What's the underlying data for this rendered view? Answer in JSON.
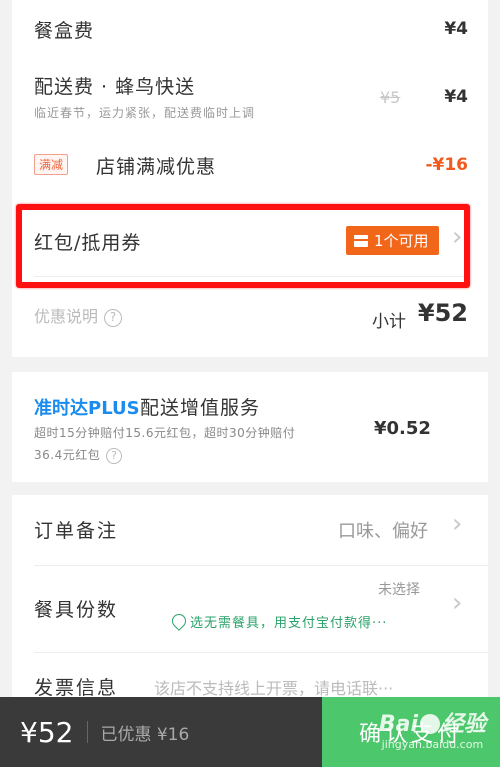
{
  "fees": {
    "box_fee_label": "餐盒费",
    "box_fee_value": "¥4",
    "delivery_label": "配送费 · 蜂鸟快送",
    "delivery_note": "临近春节，运力紧张，配送费临时上调",
    "delivery_original": "¥5",
    "delivery_value": "¥4",
    "discount_tag": "满减",
    "discount_label": "店铺满减优惠",
    "discount_value": "-¥16"
  },
  "coupon": {
    "label": "红包/抵用券",
    "badge": "1个可用"
  },
  "summary": {
    "discount_info": "优惠说明",
    "info_icon": "?",
    "subtotal_label": "小计",
    "subtotal_value": "¥52"
  },
  "plus": {
    "brand": "准时达PLUS",
    "title": "配送增值服务",
    "note_line1": "超时15分钟赔付15.6元红包，超时30分钟赔付",
    "note_line2": "36.4元红包",
    "info_icon": "?",
    "price": "¥0.52"
  },
  "order": {
    "remark_label": "订单备注",
    "remark_hint": "口味、偏好",
    "tableware_label": "餐具份数",
    "tableware_status": "未选择",
    "tableware_promo": "选无需餐具，用支付宝付款得···",
    "invoice_label": "发票信息",
    "invoice_hint": "该店不支持线上开票，请电话联···"
  },
  "bottom_bar": {
    "total": "¥52",
    "discounted": "已优惠 ¥16",
    "confirm": "确认支付"
  },
  "watermark": {
    "logo_left": "Bai",
    "logo_right": "经验",
    "url": "jingyan.baidu.com"
  },
  "icons": {
    "chevron": "›"
  },
  "colors": {
    "accent_orange": "#f2661a",
    "discount_red": "#f05a1e",
    "plus_blue": "#1a8cf0",
    "confirm_green": "#4cc76b",
    "highlight_frame": "#ff1111"
  }
}
